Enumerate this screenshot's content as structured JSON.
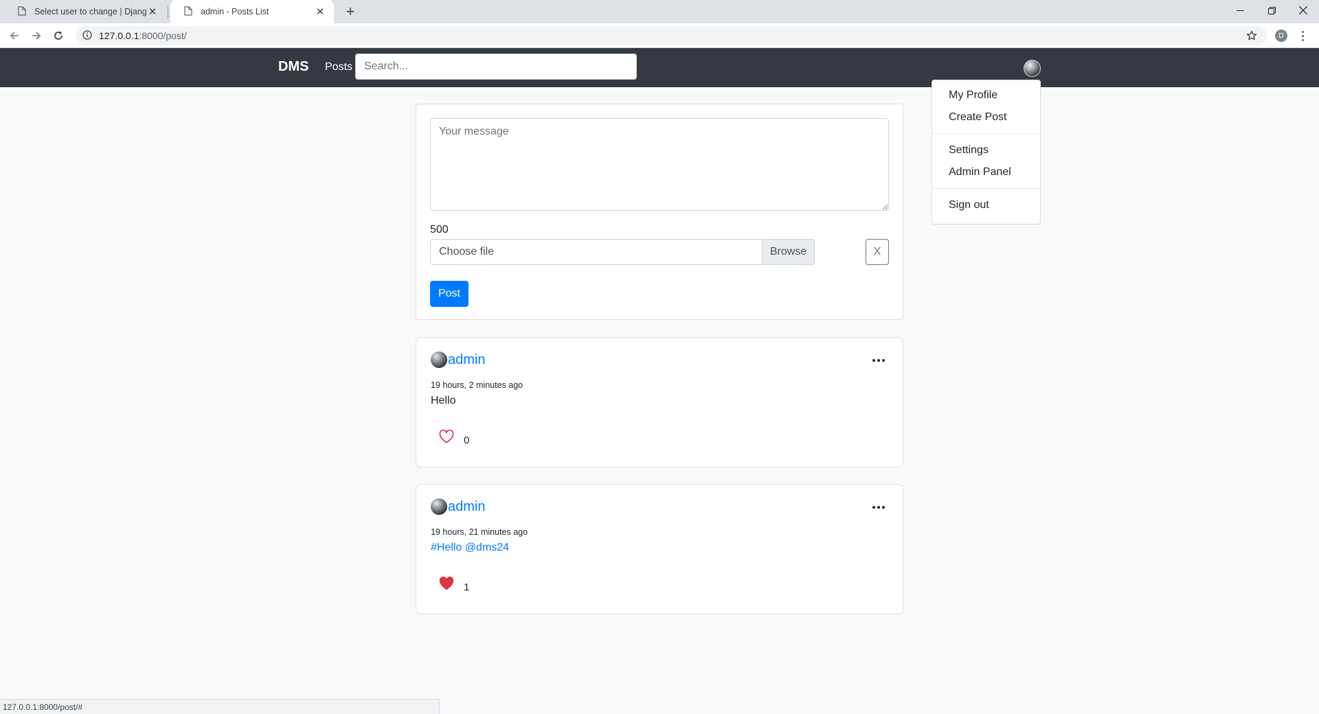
{
  "browser": {
    "tabs": [
      {
        "title": "Select user to change | Django s",
        "active": false
      },
      {
        "title": "admin - Posts List",
        "active": true
      }
    ],
    "new_tab_icon": "plus-icon",
    "url_host": "127.0.0.1",
    "url_path": ":8000/post/",
    "profile_initial": "D",
    "status_url": "127.0.0.1:8000/post/#"
  },
  "navbar": {
    "brand": "DMS",
    "posts_link": "Posts",
    "search_placeholder": "Search..."
  },
  "dropdown": {
    "items": [
      "My Profile",
      "Create Post",
      "Settings",
      "Admin Panel",
      "Sign out"
    ]
  },
  "composer": {
    "message_placeholder": "Your message",
    "char_count": "500",
    "file_label": "Choose file",
    "browse_label": "Browse",
    "clear_label": "X",
    "post_label": "Post"
  },
  "posts": [
    {
      "author": "admin",
      "time": "19 hours, 2 minutes ago",
      "body": "Hello",
      "likes": "0",
      "liked": false
    },
    {
      "author": "admin",
      "time": "19 hours, 21 minutes ago",
      "body_tags": [
        "#Hello",
        "@dms24"
      ],
      "likes": "1",
      "liked": true
    }
  ],
  "colors": {
    "navbar_bg": "#343a40",
    "primary": "#007bff",
    "like_red": "#dc3545",
    "page_bg": "#f8f9fa"
  }
}
